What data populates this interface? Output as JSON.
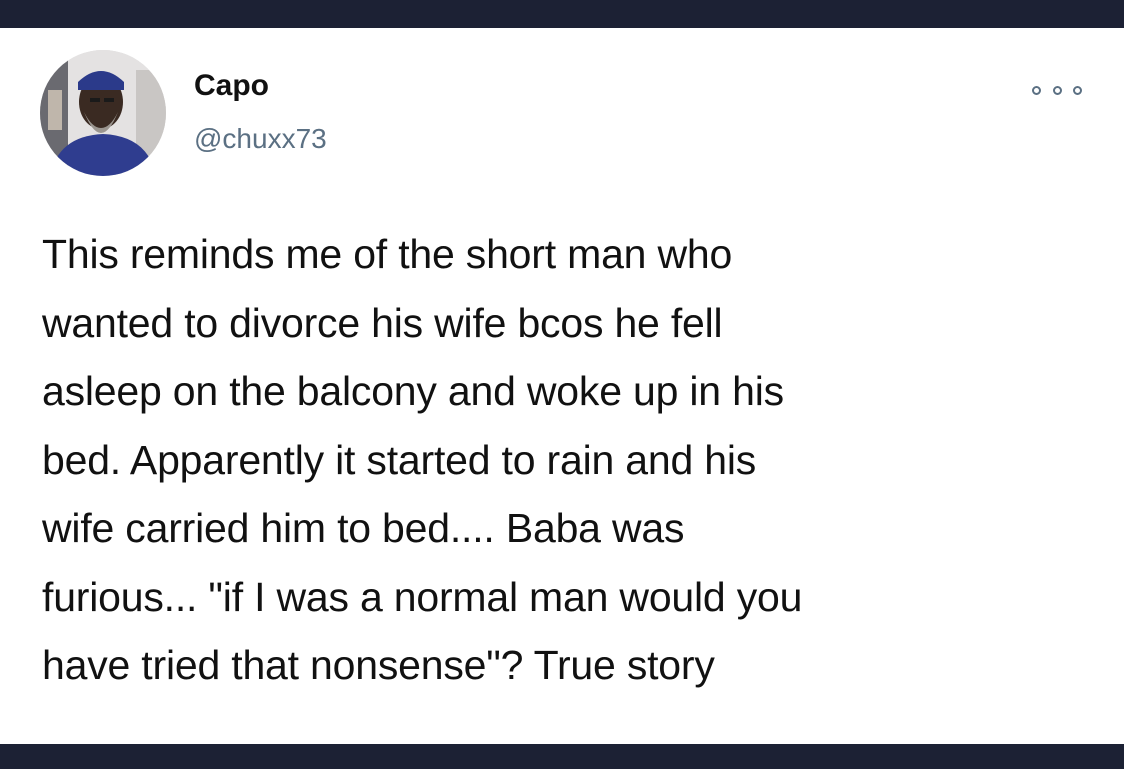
{
  "tweet": {
    "author": {
      "display_name": "Capo",
      "handle": "@chuxx73"
    },
    "more_icon": "more-options-icon",
    "text_lines": [
      "This reminds me of the short man who",
      "wanted to divorce his wife bcos he fell",
      "asleep on the balcony and woke up in his",
      "bed. Apparently it started to rain and his",
      "wife carried him to bed.... Baba was",
      "furious... \"if I was a normal man would you",
      "have tried that nonsense\"? True story"
    ]
  },
  "colors": {
    "frame_bar": "#1c2134",
    "text": "#111111",
    "secondary_text": "#5b7083",
    "background": "#ffffff"
  }
}
